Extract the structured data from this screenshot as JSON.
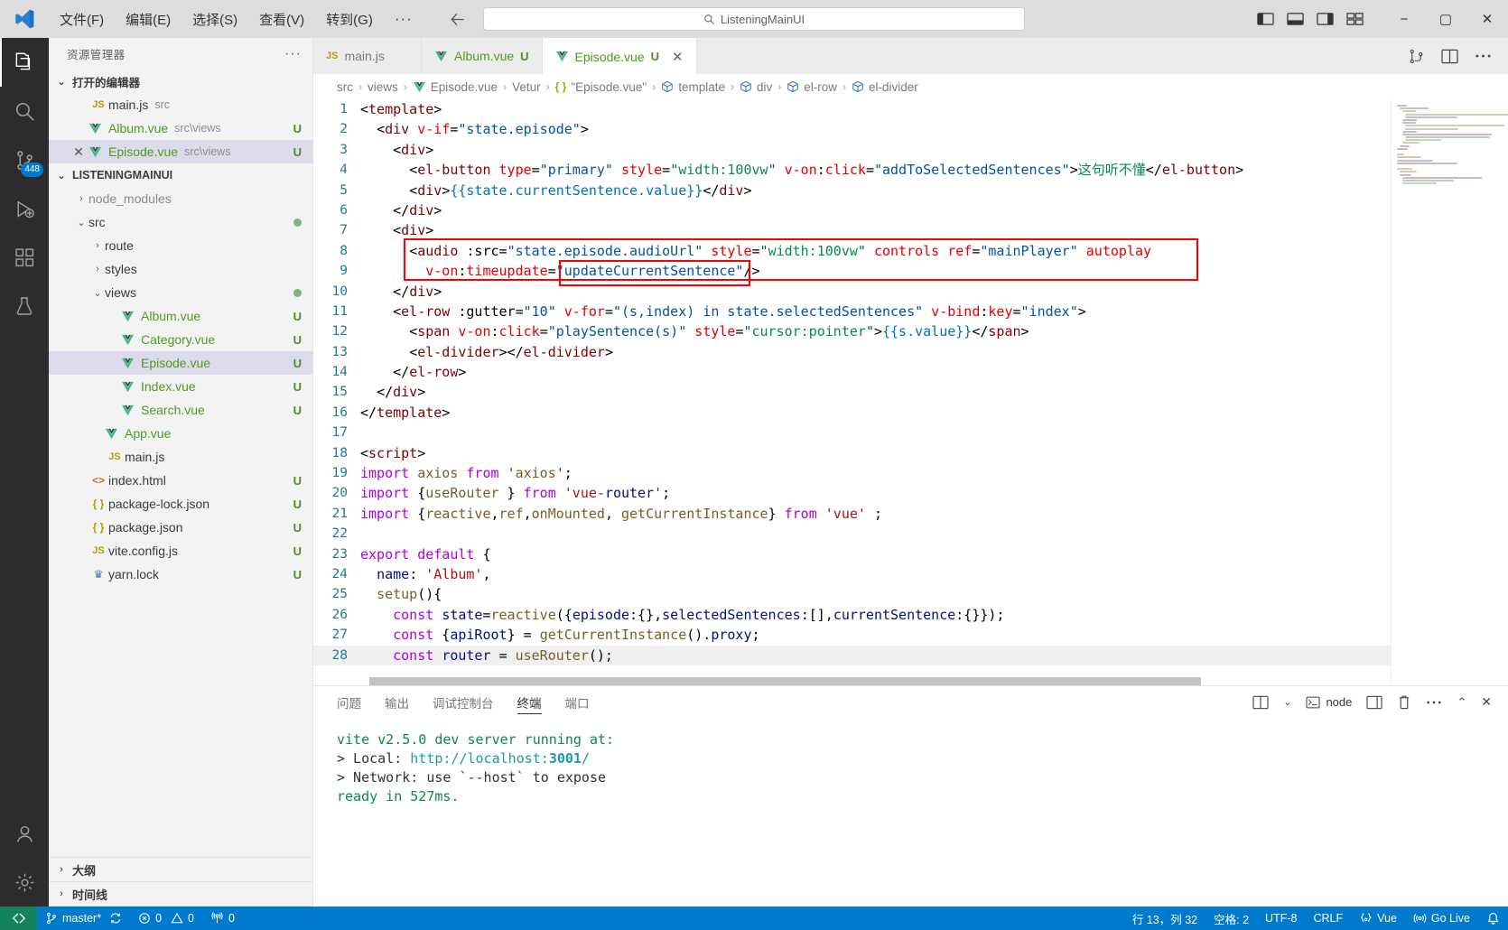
{
  "titlebar": {
    "logo_icon": "vscode-logo-icon",
    "menus": [
      "文件(F)",
      "编辑(E)",
      "选择(S)",
      "查看(V)",
      "转到(G)"
    ],
    "menu_more": "···",
    "nav_back_icon": "arrow-back-icon",
    "nav_forward_icon": "arrow-forward-icon",
    "search_placeholder": "ListeningMainUI",
    "search_icon": "search-icon",
    "layout_icons": [
      "toggle-primary-sidebar-icon",
      "toggle-panel-icon",
      "toggle-secondary-sidebar-icon",
      "customize-layout-icon"
    ],
    "window_minimize": "−",
    "window_maximize": "▢",
    "window_close": "✕"
  },
  "activitybar": {
    "items": [
      {
        "name": "explorer",
        "icon": "files-icon",
        "active": true,
        "badge": ""
      },
      {
        "name": "search",
        "icon": "search-icon",
        "active": false,
        "badge": ""
      },
      {
        "name": "source-control",
        "icon": "source-control-icon",
        "active": false,
        "badge": "448"
      },
      {
        "name": "run-debug",
        "icon": "run-debug-icon",
        "active": false,
        "badge": ""
      },
      {
        "name": "extensions",
        "icon": "extensions-icon",
        "active": false,
        "badge": ""
      },
      {
        "name": "testing",
        "icon": "beaker-icon",
        "active": false,
        "badge": ""
      }
    ],
    "bottom": [
      {
        "name": "accounts",
        "icon": "account-icon"
      },
      {
        "name": "settings",
        "icon": "gear-icon"
      }
    ]
  },
  "sidebar": {
    "title": "资源管理器",
    "more_actions": "···",
    "open_editors": {
      "label": "打开的编辑器",
      "items": [
        {
          "icon": "js-file-icon",
          "name": "main.js",
          "desc": "src",
          "status": "",
          "selected": false,
          "closable": false
        },
        {
          "icon": "vue-file-icon",
          "name": "Album.vue",
          "desc": "src\\views",
          "status": "U",
          "selected": false,
          "closable": false
        },
        {
          "icon": "vue-file-icon",
          "name": "Episode.vue",
          "desc": "src\\views",
          "status": "U",
          "selected": true,
          "closable": true
        }
      ]
    },
    "project": {
      "label": "LISTENINGMAINUI",
      "tree": [
        {
          "depth": 1,
          "kind": "folder",
          "expanded": false,
          "name": "node_modules",
          "status": "",
          "dot": false,
          "selected": false
        },
        {
          "depth": 1,
          "kind": "folder",
          "expanded": true,
          "name": "src",
          "status": "",
          "dot": true,
          "selected": false
        },
        {
          "depth": 2,
          "kind": "folder",
          "expanded": false,
          "name": "route",
          "status": "",
          "dot": false,
          "selected": false
        },
        {
          "depth": 2,
          "kind": "folder",
          "expanded": false,
          "name": "styles",
          "status": "",
          "dot": false,
          "selected": false
        },
        {
          "depth": 2,
          "kind": "folder",
          "expanded": true,
          "name": "views",
          "status": "",
          "dot": true,
          "selected": false
        },
        {
          "depth": 3,
          "kind": "vue",
          "name": "Album.vue",
          "status": "U",
          "dot": false,
          "selected": false
        },
        {
          "depth": 3,
          "kind": "vue",
          "name": "Category.vue",
          "status": "U",
          "dot": false,
          "selected": false
        },
        {
          "depth": 3,
          "kind": "vue",
          "name": "Episode.vue",
          "status": "U",
          "dot": false,
          "selected": true
        },
        {
          "depth": 3,
          "kind": "vue",
          "name": "Index.vue",
          "status": "U",
          "dot": false,
          "selected": false
        },
        {
          "depth": 3,
          "kind": "vue",
          "name": "Search.vue",
          "status": "U",
          "dot": false,
          "selected": false
        },
        {
          "depth": 2,
          "kind": "vue",
          "name": "App.vue",
          "status": "",
          "dot": false,
          "selected": false
        },
        {
          "depth": 2,
          "kind": "js",
          "name": "main.js",
          "status": "",
          "dot": false,
          "selected": false
        },
        {
          "depth": 1,
          "kind": "html",
          "name": "index.html",
          "status": "U",
          "dot": false,
          "selected": false
        },
        {
          "depth": 1,
          "kind": "json",
          "name": "package-lock.json",
          "status": "U",
          "dot": false,
          "selected": false
        },
        {
          "depth": 1,
          "kind": "json",
          "name": "package.json",
          "status": "U",
          "dot": false,
          "selected": false
        },
        {
          "depth": 1,
          "kind": "js",
          "name": "vite.config.js",
          "status": "U",
          "dot": false,
          "selected": false
        },
        {
          "depth": 1,
          "kind": "lock",
          "name": "yarn.lock",
          "status": "U",
          "dot": false,
          "selected": false
        }
      ]
    },
    "bottom_sections": [
      "大纲",
      "时间线"
    ]
  },
  "editor": {
    "tabs": [
      {
        "icon": "js-file-icon",
        "label": "main.js",
        "status": "",
        "active": false,
        "closable": false
      },
      {
        "icon": "vue-file-icon",
        "label": "Album.vue",
        "status": "U",
        "active": false,
        "closable": false
      },
      {
        "icon": "vue-file-icon",
        "label": "Episode.vue",
        "status": "U",
        "active": true,
        "closable": true
      }
    ],
    "tab_actions": [
      "split-editor-icon",
      "open-changes-icon",
      "more-actions-icon"
    ],
    "breadcrumb": [
      {
        "icon": "",
        "label": "src"
      },
      {
        "icon": "",
        "label": "views"
      },
      {
        "icon": "vue-file-icon",
        "label": "Episode.vue"
      },
      {
        "icon": "",
        "label": "Vetur"
      },
      {
        "icon": "json-symbol-icon",
        "label": "\"Episode.vue\""
      },
      {
        "icon": "symbol-field-icon",
        "label": "template"
      },
      {
        "icon": "symbol-field-icon",
        "label": "div"
      },
      {
        "icon": "symbol-field-icon",
        "label": "el-row"
      },
      {
        "icon": "symbol-field-icon",
        "label": "el-divider"
      }
    ],
    "code_lines": [
      {
        "n": 1,
        "indent": 0,
        "text": "<template>"
      },
      {
        "n": 2,
        "indent": 1,
        "text": "<div v-if=\"state.episode\">"
      },
      {
        "n": 3,
        "indent": 2,
        "text": "<div>"
      },
      {
        "n": 4,
        "indent": 3,
        "text": "<el-button type=\"primary\" style=\"width:100vw\" v-on:click=\"addToSelectedSentences\">这句听不懂</el-button>"
      },
      {
        "n": 5,
        "indent": 3,
        "text": "<div>{{state.currentSentence.value}}</div>"
      },
      {
        "n": 6,
        "indent": 2,
        "text": "</div>"
      },
      {
        "n": 7,
        "indent": 2,
        "text": "<div>"
      },
      {
        "n": 8,
        "indent": 3,
        "text": "<audio :src=\"state.episode.audioUrl\" style=\"width:100vw\" controls ref=\"mainPlayer\" autoplay"
      },
      {
        "n": 9,
        "indent": 3,
        "text": "  v-on:timeupdate=\"updateCurrentSentence\"/>"
      },
      {
        "n": 10,
        "indent": 2,
        "text": "</div>"
      },
      {
        "n": 11,
        "indent": 2,
        "text": "<el-row :gutter=\"10\" v-for=\"(s,index) in state.selectedSentences\" v-bind:key=\"index\">"
      },
      {
        "n": 12,
        "indent": 3,
        "text": "<span v-on:click=\"playSentence(s)\" style=\"cursor:pointer\">{{s.value}}</span>"
      },
      {
        "n": 13,
        "indent": 3,
        "text": "<el-divider></el-divider>"
      },
      {
        "n": 14,
        "indent": 2,
        "text": "</el-row>"
      },
      {
        "n": 15,
        "indent": 1,
        "text": "</div>"
      },
      {
        "n": 16,
        "indent": 0,
        "text": "</template>"
      },
      {
        "n": 17,
        "indent": 0,
        "text": ""
      },
      {
        "n": 18,
        "indent": 0,
        "text": "<script>"
      },
      {
        "n": 19,
        "indent": 0,
        "text": "import axios from 'axios';"
      },
      {
        "n": 20,
        "indent": 0,
        "text": "import {useRouter } from 'vue-router';"
      },
      {
        "n": 21,
        "indent": 0,
        "text": "import {reactive,ref,onMounted, getCurrentInstance} from 'vue' ;"
      },
      {
        "n": 22,
        "indent": 0,
        "text": ""
      },
      {
        "n": 23,
        "indent": 0,
        "text": "export default {"
      },
      {
        "n": 24,
        "indent": 1,
        "text": "name: 'Album',"
      },
      {
        "n": 25,
        "indent": 1,
        "text": "setup(){"
      },
      {
        "n": 26,
        "indent": 2,
        "text": "const state=reactive({episode:{},selectedSentences:[],currentSentence:{}});"
      },
      {
        "n": 27,
        "indent": 2,
        "text": "const {apiRoot} = getCurrentInstance().proxy;"
      },
      {
        "n": 28,
        "indent": 2,
        "text": "const router = useRouter();"
      }
    ],
    "annotations": [
      {
        "name": "audio-tag-highlight",
        "color": "#ff0000"
      },
      {
        "name": "updateCurrentSentence-highlight",
        "color": "#ff0000"
      }
    ]
  },
  "panel": {
    "tabs": [
      "问题",
      "输出",
      "调试控制台",
      "终端",
      "端口"
    ],
    "active_tab": "终端",
    "actions": {
      "split_icon": "split-terminal-icon",
      "chevron_icon": "chevron-down-icon",
      "shell_label": "node",
      "new_terminal_icon": "new-terminal-icon",
      "kill_icon": "trash-icon",
      "more_icon": "more-actions-icon",
      "maximize_icon": "chevron-up-icon",
      "close_icon": "close-icon"
    },
    "terminal_lines": [
      {
        "segments": [
          {
            "t": "vite v2.5.0 dev server running at:",
            "c": "green"
          }
        ]
      },
      {
        "segments": [
          {
            "t": "",
            "c": "plain"
          }
        ]
      },
      {
        "segments": [
          {
            "t": "> Local: ",
            "c": "plain"
          },
          {
            "t": "http://localhost:",
            "c": "cyan"
          },
          {
            "t": "3001",
            "c": "cyan-bold"
          },
          {
            "t": "/",
            "c": "cyan"
          }
        ]
      },
      {
        "segments": [
          {
            "t": "> Network: use `--host` to expose",
            "c": "plain"
          }
        ]
      },
      {
        "segments": [
          {
            "t": "",
            "c": "plain"
          }
        ]
      },
      {
        "segments": [
          {
            "t": "ready in 527ms.",
            "c": "green"
          }
        ]
      }
    ]
  },
  "statusbar": {
    "remote_icon": "remote-window-icon",
    "branch_icon": "source-control-branch-icon",
    "branch": "master*",
    "sync_icon": "sync-icon",
    "error_icon": "error-icon",
    "errors": "0",
    "warning_icon": "warning-icon",
    "warnings": "0",
    "ports_icon": "radio-tower-icon",
    "ports": "0",
    "cursor_position": "行 13，列 32",
    "indentation": "空格: 2",
    "encoding": "UTF-8",
    "eol": "CRLF",
    "language_icon": "vue-language-icon",
    "language": "Vue",
    "golive_icon": "broadcast-icon",
    "golive": "Go Live",
    "bell_icon": "bell-icon"
  },
  "colors": {
    "accent": "#007acc",
    "remote": "#16825d",
    "selection": "#dbdbeb",
    "vue_green": "#41b883",
    "highlight_red": "#ff0000"
  }
}
